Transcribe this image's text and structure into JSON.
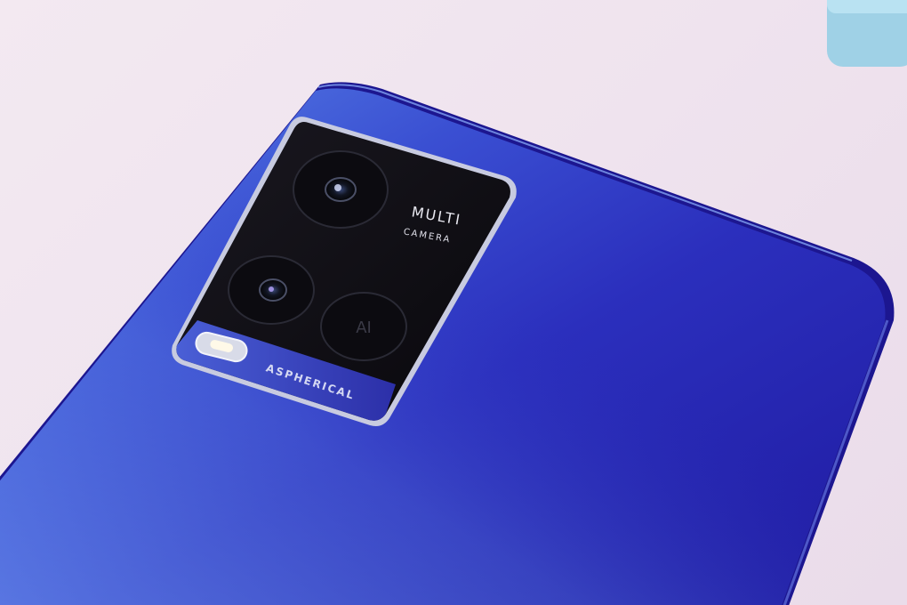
{
  "photo": {
    "subject": "smartphone-back",
    "background_color": "#efe3ee",
    "phone_color_light": "#4a6ad8",
    "phone_color_dark": "#2418a8",
    "module_color": "#0e0c14",
    "accent_object_color": "#9fd1e6"
  },
  "camera_module": {
    "title": "MULTI",
    "subtitle": "CAMERA",
    "lens_badge": "AI",
    "band_label": "ASPHERICAL"
  }
}
